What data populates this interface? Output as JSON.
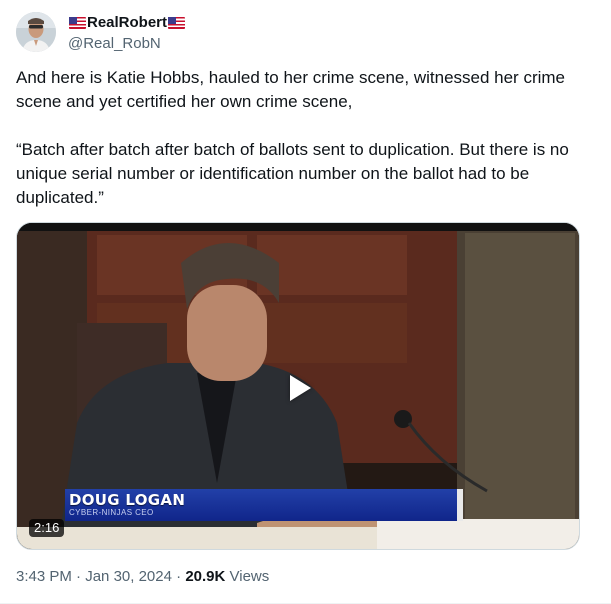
{
  "author": {
    "display_name": "RealRobert",
    "handle": "@Real_RobN",
    "flag_icons": [
      "us-flag-icon",
      "us-flag-icon"
    ]
  },
  "tweet": {
    "paragraph_1": "And here is Katie Hobbs, hauled to her crime scene, witnessed her crime scene and yet certified her own crime scene,",
    "paragraph_2": "“Batch after batch after batch of ballots sent to duplication. But there is no unique serial number or identification number on the ballot had to be duplicated.”"
  },
  "video": {
    "lower_third_name": "DOUG LOGAN",
    "lower_third_subtitle": "CYBER-NINJAS CEO",
    "duration": "2:16",
    "lower_third_color": "#10258a"
  },
  "meta": {
    "time": "3:43 PM",
    "separator": "·",
    "date": "Jan 30, 2024",
    "views_count": "20.9K",
    "views_label": "Views"
  },
  "colors": {
    "text_primary": "#0f1419",
    "text_secondary": "#536471",
    "border": "#cfd9de"
  }
}
